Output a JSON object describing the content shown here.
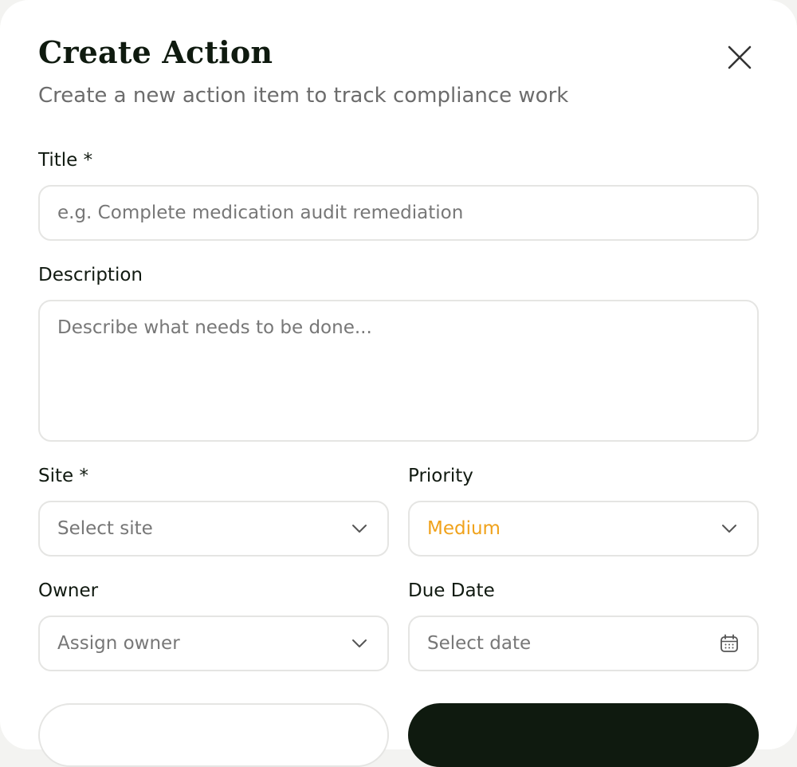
{
  "dialog": {
    "title": "Create Action",
    "subtitle": "Create a new action item to track compliance work",
    "close_icon": "close-icon"
  },
  "form": {
    "title": {
      "label": "Title *",
      "placeholder": "e.g. Complete medication audit remediation"
    },
    "description": {
      "label": "Description",
      "placeholder": "Describe what needs to be done..."
    },
    "site": {
      "label": "Site *",
      "placeholder": "Select site",
      "icon": "chevron-down-icon"
    },
    "priority": {
      "label": "Priority",
      "value": "Medium",
      "value_color": "#f0a21b",
      "icon": "chevron-down-icon"
    },
    "owner": {
      "label": "Owner",
      "placeholder": "Assign owner",
      "icon": "chevron-down-icon"
    },
    "due_date": {
      "label": "Due Date",
      "placeholder": "Select date",
      "icon": "calendar-icon"
    }
  },
  "colors": {
    "primary_button": "#0f1a0f",
    "accent_priority_medium": "#f0a21b"
  }
}
